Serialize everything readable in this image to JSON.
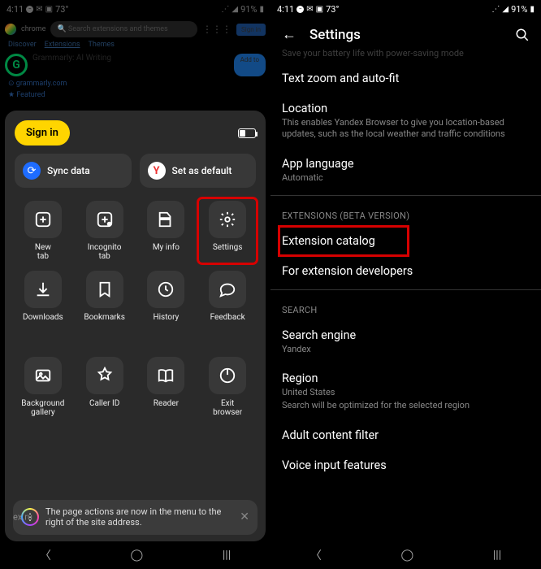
{
  "statusbar": {
    "time": "4:11",
    "temp": "73°",
    "battery": "91%"
  },
  "backdrop": {
    "app_label": "chrome",
    "search_placeholder": "Search extensions and themes",
    "signin_label": "Sign in",
    "tabs": [
      "Discover",
      "Extensions",
      "Themes"
    ],
    "card_title": "Grammarly: AI Writing",
    "add_label": "Add to",
    "card_link": "⊙ grammarly.com",
    "featured": "★ Featured"
  },
  "sheet": {
    "signin_label": "Sign in",
    "sync_label": "Sync data",
    "default_label": "Set as default",
    "tiles": [
      {
        "name": "new-tab",
        "label": "New\ntab"
      },
      {
        "name": "incognito-tab",
        "label": "Incognito\ntab"
      },
      {
        "name": "my-info",
        "label": "My info"
      },
      {
        "name": "settings",
        "label": "Settings"
      },
      {
        "name": "downloads",
        "label": "Downloads"
      },
      {
        "name": "bookmarks",
        "label": "Bookmarks"
      },
      {
        "name": "history",
        "label": "History"
      },
      {
        "name": "feedback",
        "label": "Feedback"
      },
      {
        "name": "bg-gallery",
        "label": "Background\ngallery"
      },
      {
        "name": "caller-id",
        "label": "Caller ID"
      },
      {
        "name": "reader",
        "label": "Reader"
      },
      {
        "name": "exit-browser",
        "label": "Exit\nbrowser"
      }
    ],
    "tip_edge": "ex.ru",
    "tip_text": "The page actions are now in the menu to the right of the site address."
  },
  "settings": {
    "title": "Settings",
    "cutoff_line": "Save your battery life with power-saving mode",
    "items": [
      {
        "type": "item",
        "label": "Text zoom and auto-fit"
      },
      {
        "type": "item",
        "label": "Location",
        "sub": "This enables Yandex Browser to give you location-based updates, such as the local weather and traffic conditions"
      },
      {
        "type": "item",
        "label": "App language",
        "sub": "Automatic"
      },
      {
        "type": "header",
        "label": "EXTENSIONS (BETA VERSION)"
      },
      {
        "type": "item",
        "label": "Extension catalog",
        "highlight": true
      },
      {
        "type": "item",
        "label": "For extension developers"
      },
      {
        "type": "header",
        "label": "SEARCH"
      },
      {
        "type": "item",
        "label": "Search engine",
        "sub": "Yandex"
      },
      {
        "type": "item",
        "label": "Region",
        "sub": "United States",
        "sub2": "Search will be optimized for the selected region"
      },
      {
        "type": "item",
        "label": "Adult content filter"
      },
      {
        "type": "item",
        "label": "Voice input features"
      }
    ]
  }
}
